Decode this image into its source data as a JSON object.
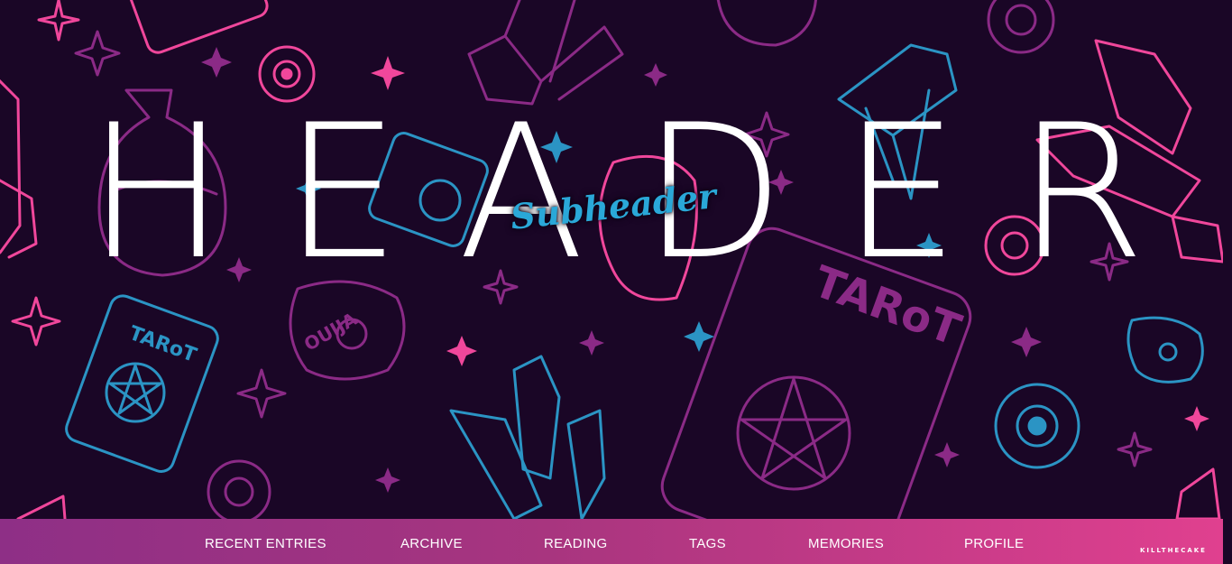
{
  "header": {
    "title": "HEADER",
    "subtitle": "Subheader"
  },
  "background": {
    "motif_labels": {
      "tarot": "TARoT",
      "ouija": "OUIJA"
    },
    "colors": {
      "base": "#1a0626",
      "pink": "#f0479b",
      "purple": "#8b2a86",
      "blue": "#2b94c4"
    }
  },
  "nav": {
    "items": [
      {
        "label": "RECENT ENTRIES"
      },
      {
        "label": "ARCHIVE"
      },
      {
        "label": "READING"
      },
      {
        "label": "TAGS"
      },
      {
        "label": "MEMORIES"
      },
      {
        "label": "PROFILE"
      }
    ],
    "gradient_start": "#8e2f86",
    "gradient_end": "#e0408f"
  },
  "credit": "KILLTHECAKE"
}
